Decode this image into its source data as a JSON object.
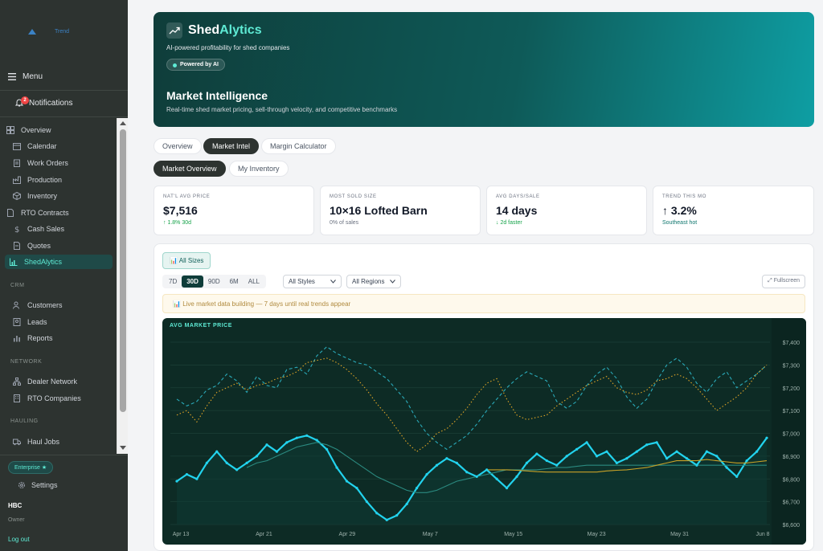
{
  "sidebar": {
    "logo_text": "Trend",
    "menu_label": "Menu",
    "notifications": {
      "label": "Notifications",
      "count": "2"
    },
    "nav": [
      {
        "label": "Overview",
        "icon": "grid-icon"
      },
      {
        "label": "Calendar",
        "icon": "calendar-icon"
      },
      {
        "label": "Work Orders",
        "icon": "clipboard-icon"
      },
      {
        "label": "Production",
        "icon": "factory-icon"
      },
      {
        "label": "Inventory",
        "icon": "box-icon"
      },
      {
        "label": "RTO Contracts",
        "icon": "document-icon"
      },
      {
        "label": "Cash Sales",
        "icon": "dollar-icon"
      },
      {
        "label": "Quotes",
        "icon": "file-icon"
      },
      {
        "label": "ShedAlytics",
        "icon": "chart-icon",
        "active": true
      }
    ],
    "sections": {
      "crm": {
        "heading": "CRM",
        "items": [
          "Customers",
          "Leads",
          "Reports"
        ]
      },
      "network": {
        "heading": "NETWORK",
        "items": [
          "Dealer Network",
          "RTO Companies"
        ]
      },
      "hauling": {
        "heading": "HAULING",
        "items": [
          "Haul Jobs"
        ]
      }
    },
    "plan_badge": "Enterprise ★",
    "settings_label": "Settings",
    "user": {
      "name": "HBC",
      "role": "Owner"
    },
    "logout_label": "Log out"
  },
  "hero": {
    "brand_part1": "Shed",
    "brand_part2": "Alytics",
    "tagline": "AI-powered profitability for shed companies",
    "pill": "Powered by AI",
    "title": "Market Intelligence",
    "subtitle": "Real-time shed market pricing, sell-through velocity, and competitive benchmarks"
  },
  "tabs": [
    "Overview",
    "Market Intel",
    "Margin Calculator"
  ],
  "active_tab": "Market Intel",
  "subtabs": [
    "Market Overview",
    "My Inventory"
  ],
  "active_subtab": "Market Overview",
  "kpis": [
    {
      "label": "NAT'L AVG PRICE",
      "value": "$7,516",
      "note": "↑ 1.8% 30d",
      "note_color": "#16a34a"
    },
    {
      "label": "MOST SOLD SIZE",
      "value": "10×16 Lofted Barn",
      "note": "0% of sales",
      "note_color": "#6b7280"
    },
    {
      "label": "AVG DAYS/SALE",
      "value": "14 days",
      "note": "↓ 2d faster",
      "note_color": "#16a34a"
    },
    {
      "label": "TREND THIS MO",
      "value": "↑ 3.2%",
      "note": "Southeast hot",
      "note_color": "#0f766e"
    }
  ],
  "controls": {
    "sizes_button": "All Sizes",
    "ranges": [
      "7D",
      "30D",
      "90D",
      "6M",
      "ALL"
    ],
    "active_range": "30D",
    "style_select": "All Styles",
    "region_select": "All Regions",
    "fullscreen": "Fullscreen",
    "notice": "Live market data building — 7 days until real trends appear"
  },
  "colors": {
    "accent": "#14b8a6",
    "hero_dark": "#0f3d3a",
    "chart_bg": "#0d2b25",
    "cyan": "#22d3ee",
    "gold": "#eab308"
  },
  "chart_data": {
    "type": "line",
    "title": "AVG MARKET PRICE",
    "x_ticks": [
      "Apr 13",
      "Apr 21",
      "Apr 29",
      "May 7",
      "May 15",
      "May 23",
      "May 31",
      "Jun 8"
    ],
    "y_ticks": [
      "$6,600",
      "$6,700",
      "$6,800",
      "$6,900",
      "$7,000",
      "$7,100",
      "$7,200",
      "$7,300",
      "$7,400"
    ],
    "ylim": [
      6600,
      7400
    ],
    "x_count": 60,
    "series": [
      {
        "style": "dashed",
        "color": "#2aa9b8",
        "values": [
          7150,
          7120,
          7140,
          7190,
          7210,
          7260,
          7230,
          7180,
          7250,
          7210,
          7200,
          7280,
          7290,
          7260,
          7340,
          7380,
          7350,
          7330,
          7310,
          7300,
          7270,
          7240,
          7190,
          7140,
          7060,
          7000,
          6960,
          6930,
          6960,
          6990,
          7040,
          7100,
          7150,
          7200,
          7240,
          7270,
          7250,
          7230,
          7140,
          7110,
          7140,
          7210,
          7260,
          7290,
          7240,
          7160,
          7110,
          7150,
          7230,
          7300,
          7330,
          7290,
          7220,
          7180,
          7240,
          7270,
          7200,
          7230,
          7260,
          7300
        ]
      },
      {
        "style": "dotted",
        "color": "#e0a526",
        "values": [
          7080,
          7100,
          7050,
          7120,
          7180,
          7200,
          7220,
          7190,
          7210,
          7220,
          7240,
          7250,
          7270,
          7310,
          7320,
          7330,
          7310,
          7280,
          7240,
          7190,
          7130,
          7080,
          7020,
          6960,
          6920,
          6950,
          7000,
          7020,
          7060,
          7110,
          7170,
          7220,
          7240,
          7150,
          7080,
          7060,
          7070,
          7080,
          7120,
          7150,
          7180,
          7210,
          7230,
          7250,
          7200,
          7180,
          7170,
          7190,
          7230,
          7240,
          7260,
          7240,
          7200,
          7150,
          7100,
          7130,
          7160,
          7200,
          7260,
          7300
        ]
      },
      {
        "style": "solid",
        "color": "#22d3ee",
        "values": [
          6790,
          6820,
          6800,
          6870,
          6920,
          6870,
          6840,
          6870,
          6900,
          6950,
          6920,
          6960,
          6980,
          6990,
          6970,
          6930,
          6850,
          6790,
          6760,
          6700,
          6650,
          6620,
          6640,
          6690,
          6760,
          6820,
          6860,
          6890,
          6870,
          6830,
          6810,
          6840,
          6800,
          6760,
          6810,
          6870,
          6910,
          6880,
          6860,
          6900,
          6930,
          6960,
          6900,
          6920,
          6870,
          6890,
          6920,
          6950,
          6960,
          6890,
          6920,
          6890,
          6860,
          6920,
          6900,
          6850,
          6810,
          6880,
          6920,
          6980
        ]
      },
      {
        "style": "solid",
        "color": "#2b8a80",
        "values": [
          null,
          null,
          null,
          null,
          null,
          null,
          null,
          6850,
          6870,
          6880,
          6900,
          6920,
          6940,
          6950,
          6960,
          6950,
          6930,
          6900,
          6870,
          6840,
          6810,
          6790,
          6770,
          6750,
          6740,
          6740,
          6750,
          6770,
          6790,
          6800,
          6810,
          6820,
          6830,
          6840,
          6840,
          6840,
          6840,
          6845,
          6850,
          6850,
          6855,
          6860,
          6860,
          6860,
          6860,
          6860,
          6860,
          6860,
          6860,
          6860,
          6860,
          6860,
          6860,
          6860,
          6860,
          6860,
          6860,
          6860,
          6860,
          6860
        ]
      },
      {
        "style": "solid",
        "color": "#c9a227",
        "values": [
          null,
          null,
          null,
          null,
          null,
          null,
          null,
          null,
          null,
          null,
          null,
          null,
          null,
          null,
          null,
          null,
          null,
          null,
          null,
          null,
          null,
          null,
          null,
          null,
          null,
          null,
          null,
          null,
          null,
          null,
          null,
          6840,
          6840,
          6840,
          6838,
          6835,
          6832,
          6830,
          6830,
          6830,
          6830,
          6830,
          6830,
          6835,
          6838,
          6840,
          6845,
          6850,
          6860,
          6870,
          6880,
          6880,
          6880,
          6885,
          6880,
          6875,
          6870,
          6870,
          6875,
          6880
        ]
      }
    ]
  }
}
